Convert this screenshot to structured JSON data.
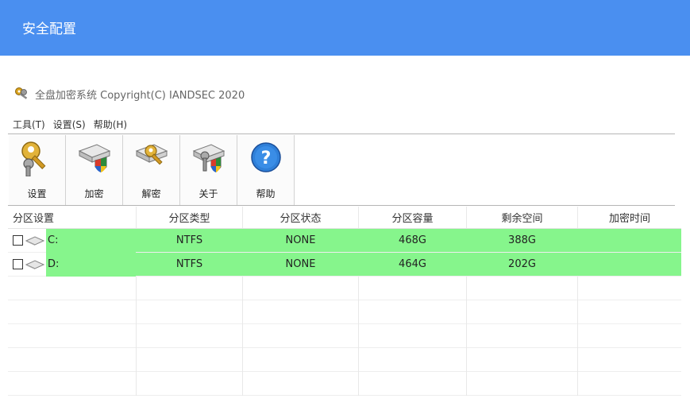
{
  "window": {
    "title": "安全配置"
  },
  "app_line": {
    "text": "全盘加密系统 Copyright(C) IANDSEC 2020",
    "icon": "keys-icon"
  },
  "menu": [
    {
      "label": "工具(T)"
    },
    {
      "label": "设置(S)"
    },
    {
      "label": "帮助(H)"
    }
  ],
  "toolbar": [
    {
      "label": "设置",
      "icon": "key-settings-icon"
    },
    {
      "label": "加密",
      "icon": "encrypt-drive-icon"
    },
    {
      "label": "解密",
      "icon": "decrypt-drive-icon"
    },
    {
      "label": "关于",
      "icon": "about-drive-icon"
    },
    {
      "label": "帮助",
      "icon": "help-icon"
    }
  ],
  "table": {
    "columns": [
      "分区设置",
      "分区类型",
      "分区状态",
      "分区容量",
      "剩余空间",
      "加密时间"
    ],
    "rows": [
      {
        "drive": "C:",
        "type": "NTFS",
        "status": "NONE",
        "capacity": "468G",
        "free": "388G",
        "encrypt_time": ""
      },
      {
        "drive": "D:",
        "type": "NTFS",
        "status": "NONE",
        "capacity": "464G",
        "free": "202G",
        "encrypt_time": ""
      }
    ],
    "highlight_color": "#86f58c"
  },
  "colors": {
    "titlebar": "#4a8ff0",
    "row_highlight": "#86f58c"
  }
}
